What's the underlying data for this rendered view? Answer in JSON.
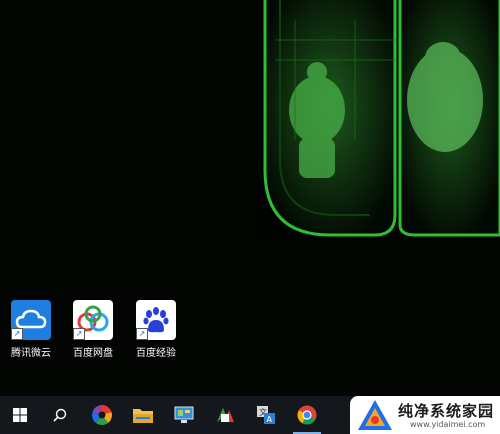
{
  "desktop": {
    "icons": [
      {
        "label": "腾讯微云",
        "icon": "weiyun-cloud-icon"
      },
      {
        "label": "百度网盘",
        "icon": "baidu-netdisk-icon"
      },
      {
        "label": "百度经验",
        "icon": "baidu-paw-icon"
      }
    ]
  },
  "taskbar": {
    "apps": [
      "start-windows-icon",
      "search-icon",
      "app-colorwheel-icon",
      "file-explorer-icon",
      "control-panel-icon",
      "media-app-icon",
      "translate-icon",
      "chrome-icon"
    ],
    "accent": "#7fb3e8"
  },
  "watermark": {
    "title": "纯净系统家园",
    "url": "www.yidaimei.com"
  }
}
